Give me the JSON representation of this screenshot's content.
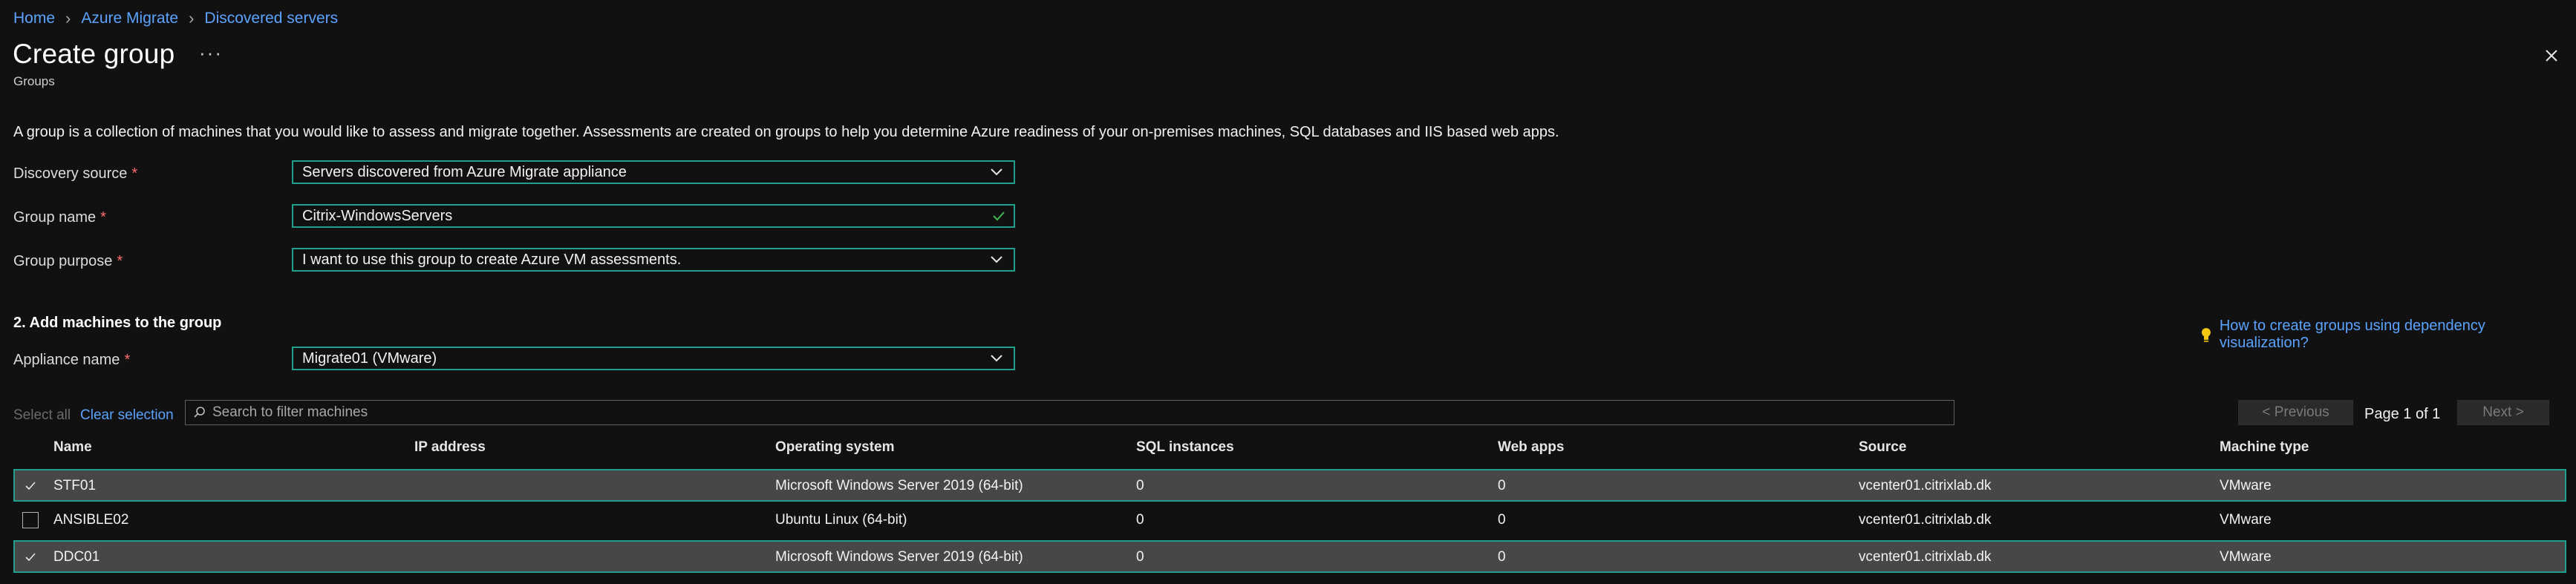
{
  "breadcrumb": [
    "Home",
    "Azure Migrate",
    "Discovered servers"
  ],
  "header": {
    "title": "Create group",
    "more": "···",
    "subtitle": "Groups"
  },
  "description": "A group is a collection of machines that you would like to assess and migrate together. Assessments are created on groups to help you determine Azure readiness of your on-premises machines, SQL databases and IIS based web apps.",
  "form": {
    "discovery_source": {
      "label": "Discovery source",
      "value": "Servers discovered from Azure Migrate appliance"
    },
    "group_name": {
      "label": "Group name",
      "value": "Citrix-WindowsServers"
    },
    "group_purpose": {
      "label": "Group purpose",
      "value": "I want to use this group to create Azure VM assessments."
    },
    "required_marker": "*"
  },
  "section2": {
    "title": "2. Add machines to the group",
    "help_link": "How to create groups using dependency visualization?",
    "appliance": {
      "label": "Appliance name",
      "value": "Migrate01 (VMware)"
    }
  },
  "filter": {
    "select_all": "Select all",
    "clear_selection": "Clear selection",
    "search_placeholder": "Search to filter machines"
  },
  "pagination": {
    "previous": "< Previous",
    "page_info": "Page 1 of 1",
    "next": "Next >"
  },
  "table": {
    "columns": [
      "Name",
      "IP address",
      "Operating system",
      "SQL instances",
      "Web apps",
      "Source",
      "Machine type"
    ],
    "rows": [
      {
        "selected": true,
        "name": "STF01",
        "ip": "",
        "os": "Microsoft Windows Server 2019 (64-bit)",
        "sql": "0",
        "web": "0",
        "source": "vcenter01.citrixlab.dk",
        "type": "VMware"
      },
      {
        "selected": false,
        "name": "ANSIBLE02",
        "ip": "",
        "os": "Ubuntu Linux (64-bit)",
        "sql": "0",
        "web": "0",
        "source": "vcenter01.citrixlab.dk",
        "type": "VMware"
      },
      {
        "selected": true,
        "name": "DDC01",
        "ip": "",
        "os": "Microsoft Windows Server 2019 (64-bit)",
        "sql": "0",
        "web": "0",
        "source": "vcenter01.citrixlab.dk",
        "type": "VMware"
      }
    ]
  },
  "colors": {
    "accent": "#1fa08e",
    "link": "#5aa3ff",
    "background": "#111111",
    "selected_row": "#474747",
    "required": "#ff6b6b"
  }
}
